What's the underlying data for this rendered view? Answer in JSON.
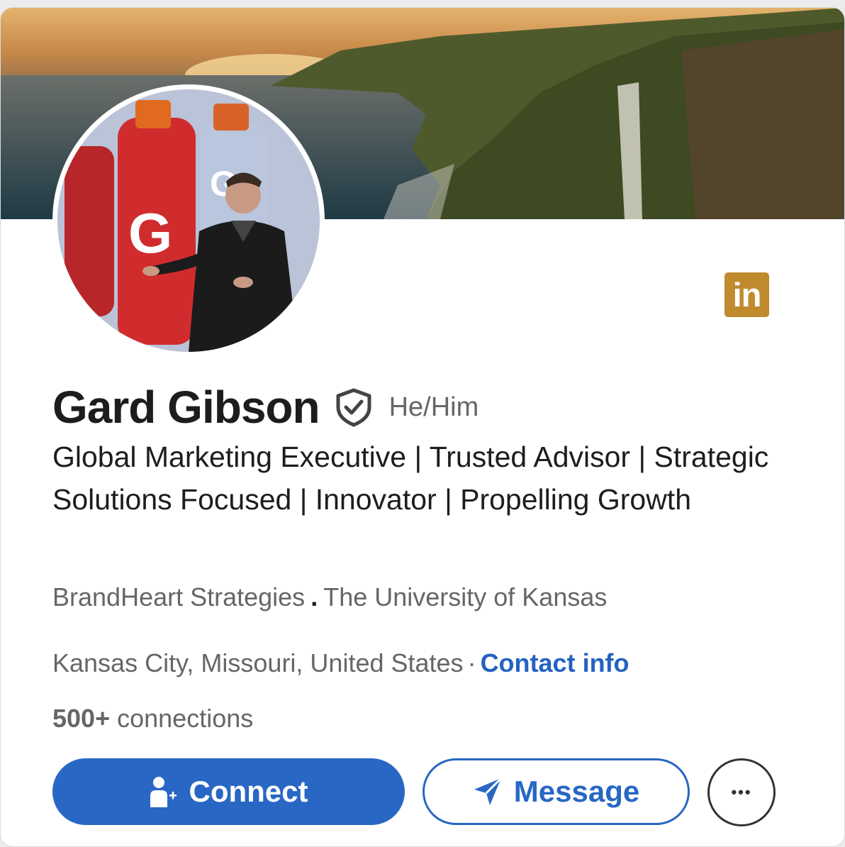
{
  "profile": {
    "name": "Gard Gibson",
    "pronouns": "He/Him",
    "headline": "Global Marketing Executive | Trusted Advisor | Strategic Solutions Focused | Innovator | Propelling Growth",
    "company": "BrandHeart Strategies",
    "separator": ".",
    "school": "The University of Kansas",
    "location": "Kansas City, Missouri, United States",
    "location_dot": "·",
    "contact_label": "Contact info",
    "connections_count": "500+",
    "connections_label": "connections"
  },
  "branding": {
    "logo_text": "in",
    "logo_color": "#c08a2e",
    "accent": "#2867c4",
    "link_color": "#2462c2"
  },
  "icons": {
    "verified": "verified-shield-icon",
    "connect": "add-person-icon",
    "message": "send-icon",
    "more": "more-horizontal-icon"
  },
  "actions": {
    "connect_label": "Connect",
    "message_label": "Message",
    "more_label": "•••"
  }
}
